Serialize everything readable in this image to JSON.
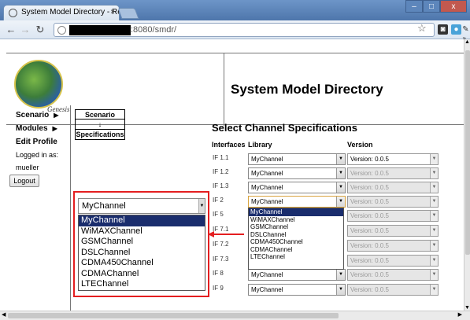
{
  "browser": {
    "tab_title": "System Model Directory - Repo",
    "tab_close": "×",
    "url_suffix": ":8080/smdr/",
    "win_min": "–",
    "win_max": "□",
    "win_close": "x",
    "chevron": "»"
  },
  "header": {
    "logo_text": "Genesis",
    "title": "System Model Directory"
  },
  "nav": {
    "scenario": "Scenario",
    "modules": "Modules",
    "edit_profile": "Edit Profile",
    "logged_in_as": "Logged in as:",
    "username": "mueller",
    "logout": "Logout"
  },
  "breadcrumb": {
    "top": "Scenario",
    "arrow": "↓",
    "bottom": "Specifications"
  },
  "main": {
    "title": "Select Channel Specifications",
    "col_interfaces": "Interfaces",
    "col_library": "Library",
    "col_version": "Version",
    "rows": [
      {
        "iface": "IF 1.1",
        "library": "MyChannel",
        "version": "Version: 0.0.5",
        "version_enabled": true
      },
      {
        "iface": "IF 1.2",
        "library": "MyChannel",
        "version": "Version: 0.0.5",
        "version_enabled": false
      },
      {
        "iface": "IF 1.3",
        "library": "MyChannel",
        "version": "Version: 0.0.5",
        "version_enabled": false
      },
      {
        "iface": "IF 2",
        "library": "MyChannel",
        "version": "Version: 0.0.5",
        "version_enabled": false
      },
      {
        "iface": "IF 5",
        "library": "",
        "version": "Version: 0.0.5",
        "version_enabled": false
      },
      {
        "iface": "IF 7.1",
        "library": "",
        "version": "Version: 0.0.5",
        "version_enabled": false
      },
      {
        "iface": "IF 7.2",
        "library": "",
        "version": "Version: 0.0.5",
        "version_enabled": false
      },
      {
        "iface": "IF 7.3",
        "library": "",
        "version": "Version: 0.0.5",
        "version_enabled": false
      },
      {
        "iface": "IF 8",
        "library": "MyChannel",
        "version": "Version: 0.0.5",
        "version_enabled": false
      },
      {
        "iface": "IF 9",
        "library": "MyChannel",
        "version": "Version: 0.0.5",
        "version_enabled": false
      }
    ],
    "dropdown_options": [
      "MyChannel",
      "WiMAXChannel",
      "GSMChannel",
      "DSLChannel",
      "CDMA450Channel",
      "CDMAChannel",
      "LTEChannel"
    ]
  },
  "zoom": {
    "selected": "MyChannel",
    "options": [
      "MyChannel",
      "WiMAXChannel",
      "GSMChannel",
      "DSLChannel",
      "CDMA450Channel",
      "CDMAChannel",
      "LTEChannel"
    ]
  },
  "colors": {
    "highlight": "#1a2d6d",
    "callout": "#e41e20"
  }
}
